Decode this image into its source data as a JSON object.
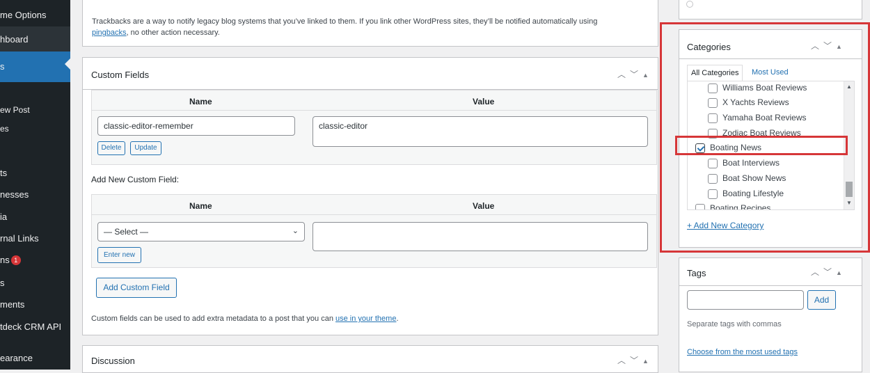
{
  "sidebar": {
    "items": [
      {
        "label": "me Options"
      },
      {
        "label": "hboard"
      },
      {
        "label": "s"
      },
      {
        "label": "ew Post"
      },
      {
        "label": "es"
      },
      {
        "label": "ts"
      },
      {
        "label": "nesses"
      },
      {
        "label": "ia"
      },
      {
        "label": "rnal Links"
      },
      {
        "label": "ns",
        "badge": "1"
      },
      {
        "label": "s"
      },
      {
        "label": "ments"
      },
      {
        "label": "tdeck CRM API"
      },
      {
        "label": "earance"
      }
    ]
  },
  "trackbacks": {
    "text": "Trackbacks are a way to notify legacy blog systems that you’ve linked to them. If you link other WordPress sites, they’ll be notified automatically using",
    "link": "pingbacks",
    "text_after": ", no other action necessary."
  },
  "custom_fields": {
    "title": "Custom Fields",
    "col_name": "Name",
    "col_value": "Value",
    "existing_name": "classic-editor-remember",
    "existing_value": "classic-editor",
    "delete_label": "Delete",
    "update_label": "Update",
    "add_new_heading": "Add New Custom Field:",
    "select_value": "— Select —",
    "enter_new_label": "Enter new",
    "add_button": "Add Custom Field",
    "footer_text": "Custom fields can be used to extra metadata to a post that you can",
    "footer_text_full_prefix": "Custom fields can be used to add extra metadata to a post that you can",
    "footer_link": "use in your theme",
    "footer_end": "."
  },
  "discussion": {
    "title": "Discussion"
  },
  "categories": {
    "title": "Categories",
    "tab_all": "All Categories",
    "tab_most_used": "Most Used",
    "items": [
      {
        "label": "Williams Boat Reviews",
        "checked": false,
        "level": 1
      },
      {
        "label": "X Yachts Reviews",
        "checked": false,
        "level": 1
      },
      {
        "label": "Yamaha Boat Reviews",
        "checked": false,
        "level": 1
      },
      {
        "label": "Zodiac Boat Reviews",
        "checked": false,
        "level": 1
      },
      {
        "label": "Boating News",
        "checked": true,
        "level": 0
      },
      {
        "label": "Boat Interviews",
        "checked": false,
        "level": 1
      },
      {
        "label": "Boat Show News",
        "checked": false,
        "level": 1
      },
      {
        "label": "Boating Lifestyle",
        "checked": false,
        "level": 1
      },
      {
        "label": "Boating Recipes",
        "checked": false,
        "level": 0
      }
    ],
    "add_new": "+ Add New Category"
  },
  "tags": {
    "title": "Tags",
    "add_label": "Add",
    "hint": "Separate tags with commas",
    "choose_link": "Choose from the most used tags"
  },
  "colors": {
    "accent": "#2271b1",
    "highlight": "#d63638",
    "sidebar": "#1d2327"
  }
}
